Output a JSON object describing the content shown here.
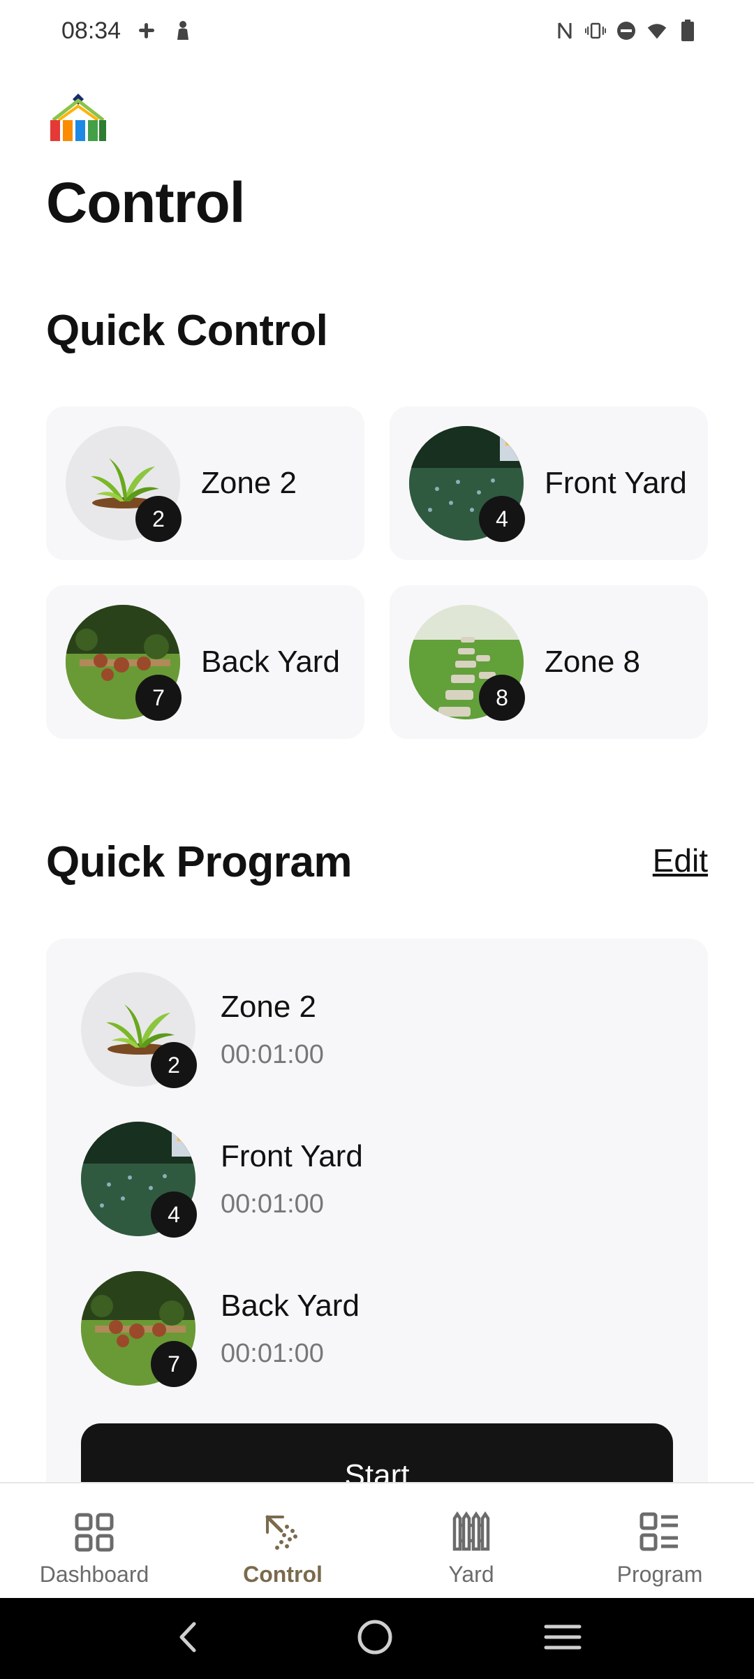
{
  "status_bar": {
    "time": "08:34",
    "left_icons": [
      "slack-icon",
      "person-icon"
    ],
    "right_icons": [
      "nfc-icon",
      "vibrate-icon",
      "dnd-icon",
      "wifi-icon",
      "battery-icon"
    ]
  },
  "page": {
    "title": "Control"
  },
  "quick_control": {
    "title": "Quick Control",
    "items": [
      {
        "label": "Zone 2",
        "badge": "2",
        "image": "plant"
      },
      {
        "label": "Front Yard",
        "badge": "4",
        "image": "front-yard"
      },
      {
        "label": "Back Yard",
        "badge": "7",
        "image": "back-yard"
      },
      {
        "label": "Zone 8",
        "badge": "8",
        "image": "path"
      }
    ]
  },
  "quick_program": {
    "title": "Quick Program",
    "edit_label": "Edit",
    "items": [
      {
        "name": "Zone 2",
        "duration": "00:01:00",
        "badge": "2",
        "image": "plant"
      },
      {
        "name": "Front Yard",
        "duration": "00:01:00",
        "badge": "4",
        "image": "front-yard"
      },
      {
        "name": "Back Yard",
        "duration": "00:01:00",
        "badge": "7",
        "image": "back-yard"
      }
    ],
    "start_label": "Start"
  },
  "bottom_nav": {
    "items": [
      {
        "label": "Dashboard",
        "icon": "grid-icon"
      },
      {
        "label": "Control",
        "icon": "sprinkler-icon",
        "active": true
      },
      {
        "label": "Yard",
        "icon": "fence-icon"
      },
      {
        "label": "Program",
        "icon": "list-icon"
      }
    ]
  },
  "colors": {
    "accent": "#7a6a4e",
    "card_bg": "#f7f7f9",
    "badge_bg": "#141414",
    "button_bg": "#141414"
  }
}
